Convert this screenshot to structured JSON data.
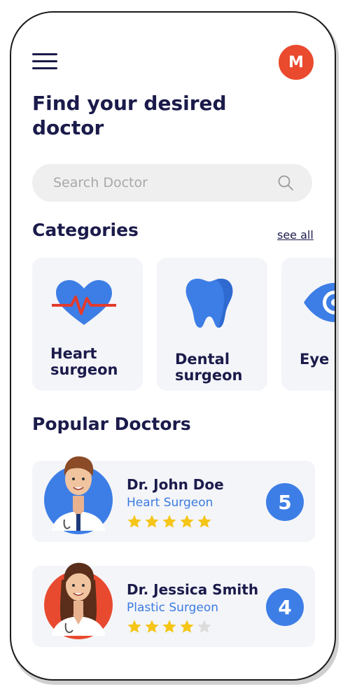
{
  "header": {
    "avatar_initial": "M"
  },
  "title": "Find your desired doctor",
  "search": {
    "placeholder": "Search Doctor"
  },
  "categories": {
    "heading": "Categories",
    "see_all": "see all",
    "items": [
      {
        "label": "Heart surgeon",
        "icon": "heart-pulse-icon"
      },
      {
        "label": "Dental surgeon",
        "icon": "tooth-icon"
      },
      {
        "label": "Eye spec",
        "icon": "eye-icon"
      }
    ]
  },
  "popular": {
    "heading": "Popular Doctors",
    "doctors": [
      {
        "name": "Dr. John Doe",
        "specialty": "Heart Surgeon",
        "rating": "5",
        "stars": 5,
        "avatar_bg": "#3d7ee6"
      },
      {
        "name": "Dr. Jessica Smith",
        "specialty": "Plastic Surgeon",
        "rating": "4",
        "stars": 4,
        "avatar_bg": "#e84a2f"
      }
    ]
  },
  "colors": {
    "navy": "#1b1b4b",
    "accent_blue": "#3d7ee6",
    "avatar_red": "#ea4a2d",
    "star_gold": "#f5c518",
    "card_bg": "#f4f5f9"
  }
}
